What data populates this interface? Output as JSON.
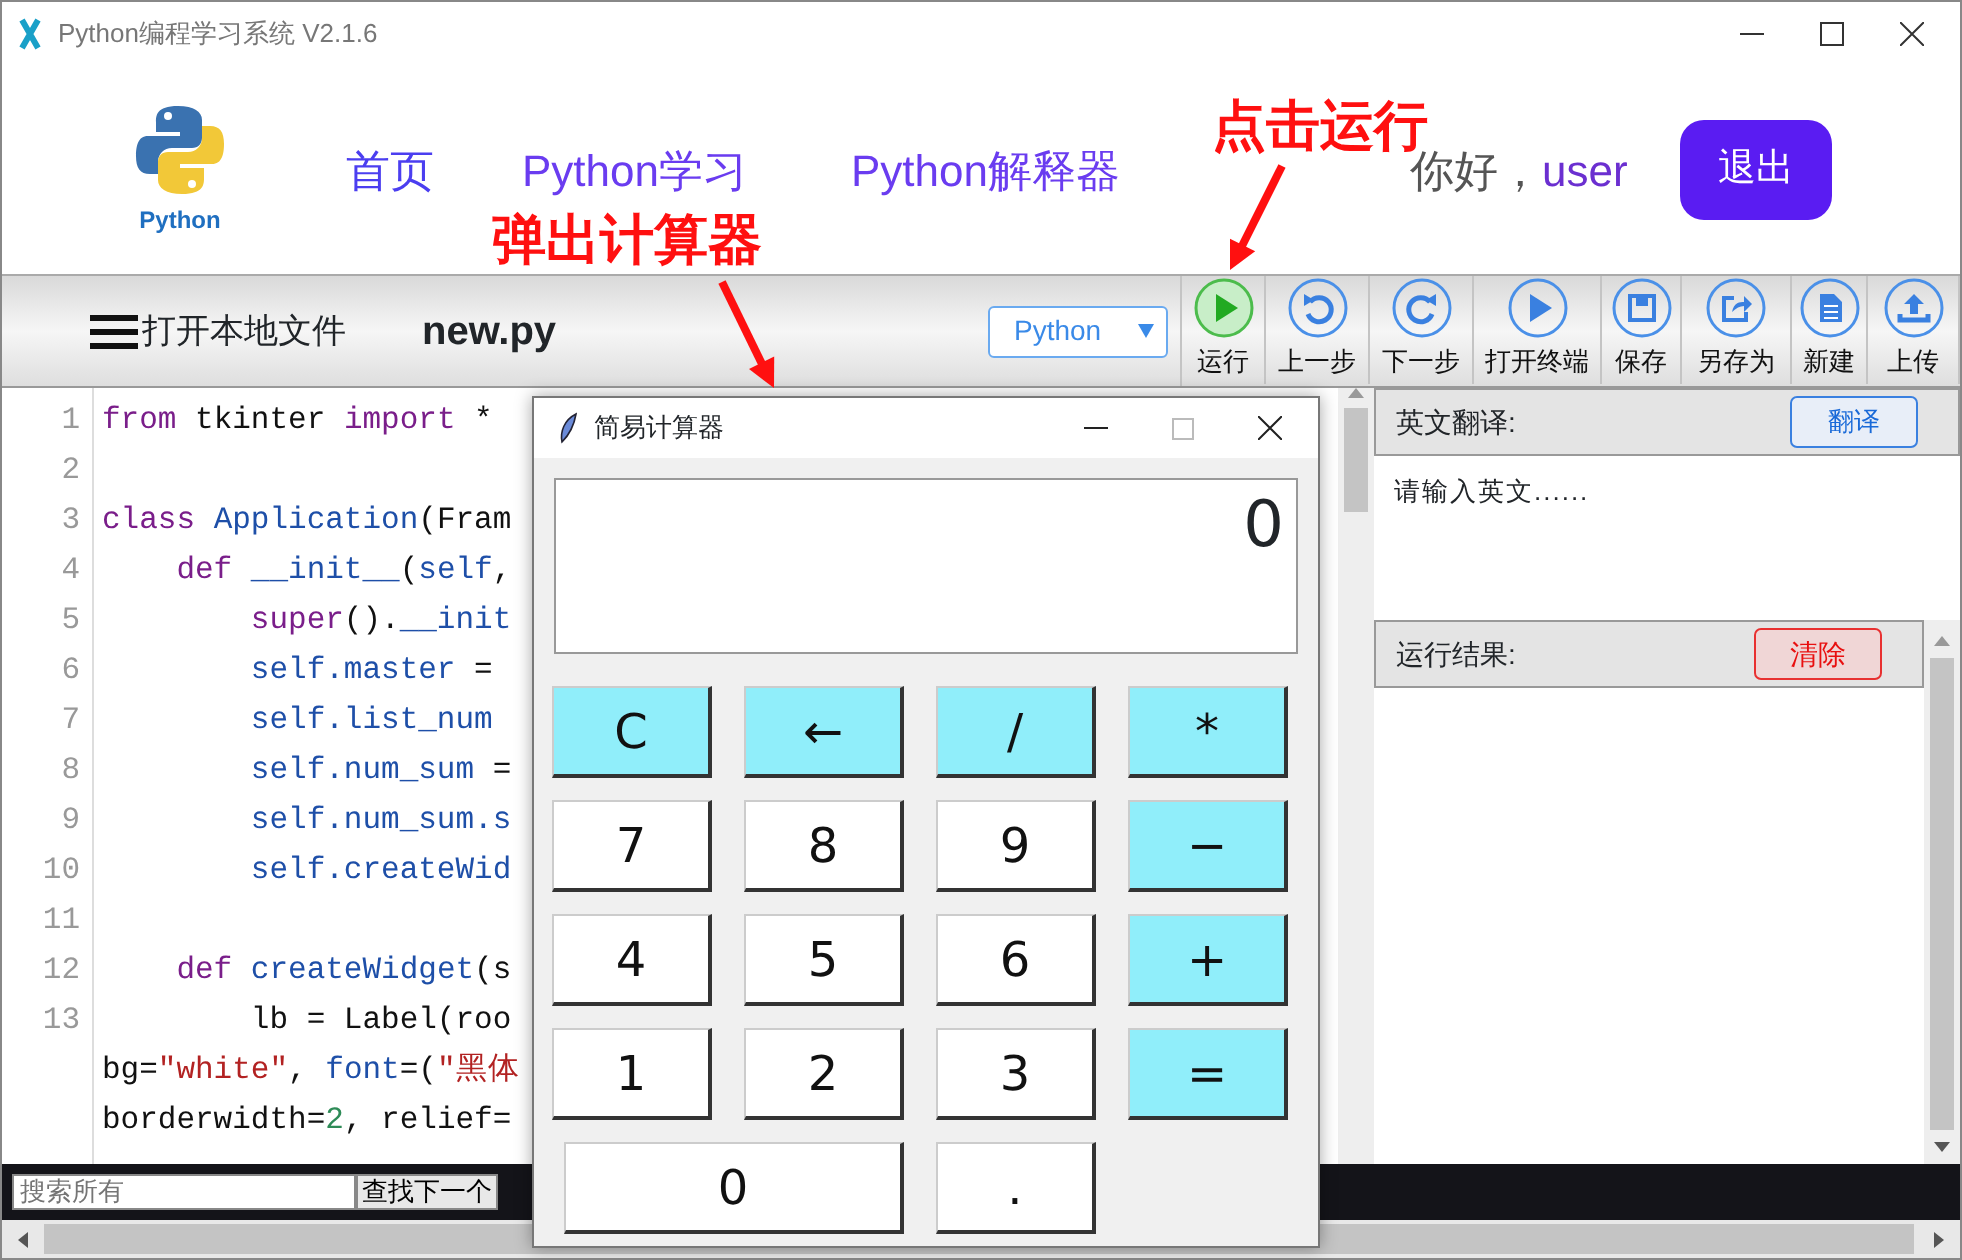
{
  "window": {
    "title": "Python编程学习系统 V2.1.6"
  },
  "header": {
    "logo_text": "Python",
    "nav": [
      {
        "label": "首页"
      },
      {
        "label": "Python学习"
      },
      {
        "label": "Python解释器"
      }
    ],
    "greeting": "你好，",
    "user": "user",
    "logout": "退出"
  },
  "toolbar": {
    "open_file": "打开本地文件",
    "filename": "new.py",
    "language": "Python",
    "buttons": [
      {
        "label": "运行",
        "kind": "run"
      },
      {
        "label": "上一步",
        "kind": "undo"
      },
      {
        "label": "下一步",
        "kind": "redo"
      },
      {
        "label": "打开终端",
        "kind": "terminal"
      },
      {
        "label": "保存",
        "kind": "save"
      },
      {
        "label": "另存为",
        "kind": "saveas"
      },
      {
        "label": "新建",
        "kind": "new"
      },
      {
        "label": "上传",
        "kind": "upload"
      }
    ]
  },
  "editor": {
    "lines": [
      {
        "number": "1",
        "tokens": [
          {
            "text": "from",
            "kind": "kw"
          },
          {
            "text": " tkinter ",
            "kind": "plain"
          },
          {
            "text": "import",
            "kind": "kw"
          },
          {
            "text": " *",
            "kind": "plain"
          }
        ]
      },
      {
        "number": "2"
      },
      {
        "number": "3",
        "tokens": [
          {
            "text": "class",
            "kind": "kw"
          },
          {
            "text": " Application",
            "kind": "name"
          },
          {
            "text": "(Fram",
            "kind": "plain"
          }
        ]
      },
      {
        "number": "4",
        "tokens": [
          {
            "text": "    def",
            "kind": "kw"
          },
          {
            "text": " __init__",
            "kind": "name"
          },
          {
            "text": "(",
            "kind": "plain"
          },
          {
            "text": "self",
            "kind": "name"
          },
          {
            "text": ",",
            "kind": "plain"
          }
        ]
      },
      {
        "number": "5",
        "tokens": [
          {
            "text": "        super",
            "kind": "kw"
          },
          {
            "text": "().",
            "kind": "plain"
          },
          {
            "text": "__init",
            "kind": "name"
          }
        ]
      },
      {
        "number": "6",
        "tokens": [
          {
            "text": "        self.master",
            "kind": "name"
          },
          {
            "text": " =",
            "kind": "plain"
          }
        ]
      },
      {
        "number": "7",
        "tokens": [
          {
            "text": "        self.list_num",
            "kind": "name"
          }
        ]
      },
      {
        "number": "8",
        "tokens": [
          {
            "text": "        self.num_sum",
            "kind": "name"
          },
          {
            "text": " =",
            "kind": "plain"
          }
        ]
      },
      {
        "number": "9",
        "tokens": [
          {
            "text": "        self.num_sum.s",
            "kind": "name"
          }
        ]
      },
      {
        "number": "10",
        "tokens": [
          {
            "text": "        self.createWid",
            "kind": "name"
          }
        ]
      },
      {
        "number": "11"
      },
      {
        "number": "12",
        "tokens": [
          {
            "text": "    def",
            "kind": "kw"
          },
          {
            "text": " createWidget",
            "kind": "name"
          },
          {
            "text": "(s",
            "kind": "plain"
          }
        ]
      },
      {
        "number": "13",
        "tokens": [
          {
            "text": "        lb = Label(roo",
            "kind": "plain"
          }
        ]
      },
      {
        "tokens": [
          {
            "text": "bg=",
            "kind": "plain"
          },
          {
            "text": "\"white\"",
            "kind": "str"
          },
          {
            "text": ", ",
            "kind": "plain"
          },
          {
            "text": "font",
            "kind": "name"
          },
          {
            "text": "=(",
            "kind": "plain"
          },
          {
            "text": "\"黑体",
            "kind": "str"
          }
        ]
      },
      {
        "tokens": [
          {
            "text": "borderwidth=",
            "kind": "plain"
          },
          {
            "text": "2",
            "kind": "num"
          },
          {
            "text": ", relief=",
            "kind": "plain"
          }
        ]
      }
    ]
  },
  "search": {
    "placeholder": "搜索所有",
    "button": "查找下一个"
  },
  "translate": {
    "label": "英文翻译:",
    "button": "翻译",
    "text": "请输入英文......"
  },
  "result": {
    "label": "运行结果:",
    "button": "清除"
  },
  "calculator": {
    "title": "简易计算器",
    "display": "0",
    "keys": [
      {
        "label": "C",
        "kind": "op"
      },
      {
        "label": "←",
        "kind": "op"
      },
      {
        "label": "/",
        "kind": "op"
      },
      {
        "label": "*",
        "kind": "op"
      },
      {
        "label": "7",
        "kind": "digit"
      },
      {
        "label": "8",
        "kind": "digit"
      },
      {
        "label": "9",
        "kind": "digit"
      },
      {
        "label": "−",
        "kind": "op"
      },
      {
        "label": "4",
        "kind": "digit"
      },
      {
        "label": "5",
        "kind": "digit"
      },
      {
        "label": "6",
        "kind": "digit"
      },
      {
        "label": "+",
        "kind": "op"
      },
      {
        "label": "1",
        "kind": "digit"
      },
      {
        "label": "2",
        "kind": "digit"
      },
      {
        "label": "3",
        "kind": "digit"
      },
      {
        "label": "=",
        "kind": "equals"
      },
      {
        "label": "0",
        "kind": "zero"
      },
      {
        "label": ".",
        "kind": "digit"
      }
    ]
  },
  "annotations": [
    {
      "text": "点击运行",
      "kind": "run"
    },
    {
      "text": "弹出计算器",
      "kind": "popup"
    }
  ]
}
